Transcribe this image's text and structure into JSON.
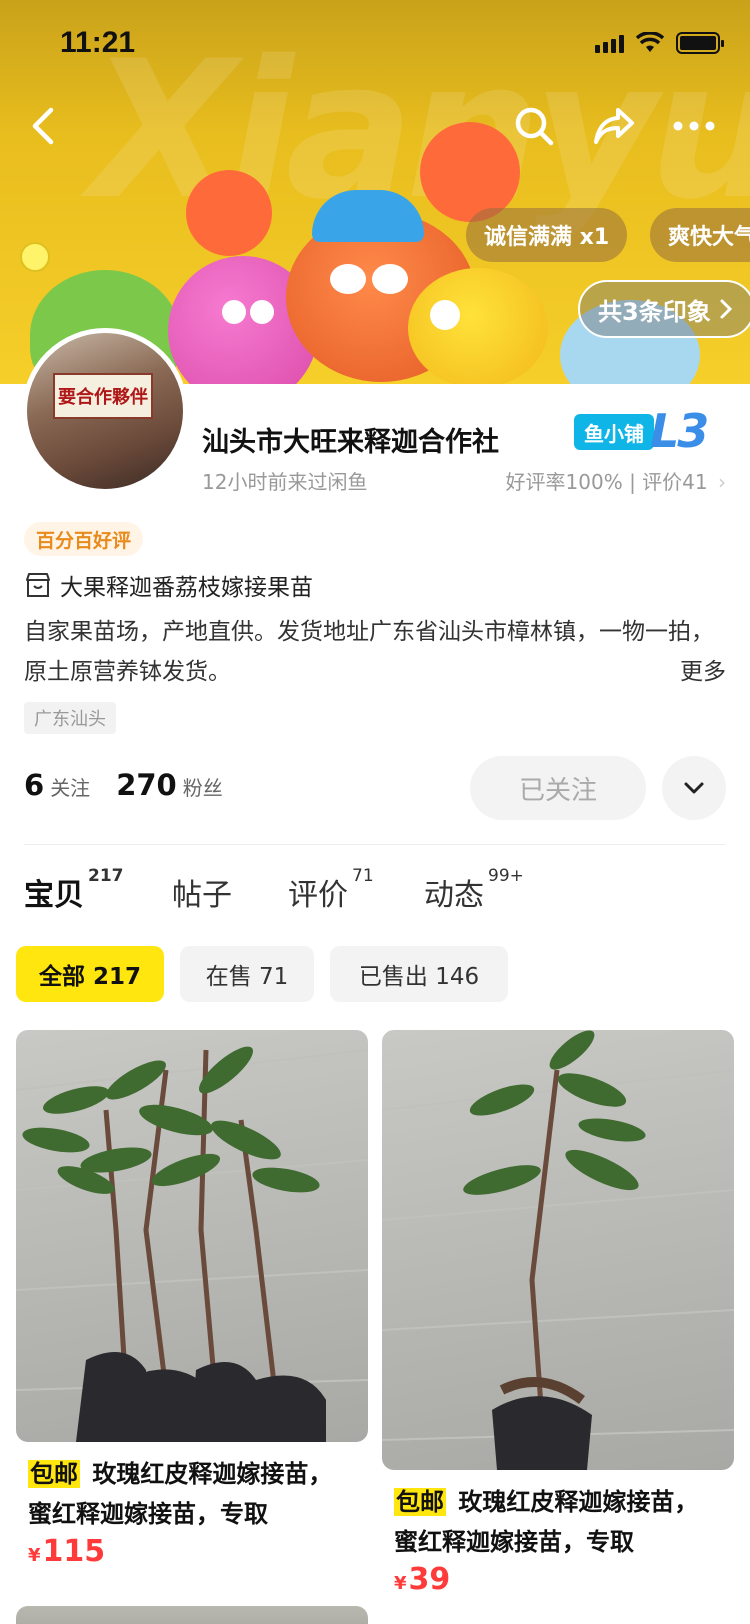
{
  "status_bar": {
    "time": "11:21"
  },
  "banner": {
    "watermark": "Xianyu",
    "tags": [
      "诚信满满 x1",
      "爽快大气"
    ],
    "impressions": "共3条印象"
  },
  "shop": {
    "avatar_text": "要合作夥伴",
    "name": "汕头市大旺来释迦合作社",
    "last_visit": "12小时前来过闲鱼",
    "level_badge": "鱼小铺",
    "level": "L3",
    "rating": "好评率100% | 评价41",
    "good_tag": "百分百好评",
    "title": "大果释迦番荔枝嫁接果苗",
    "description": "自家果苗场，产地直供。发货地址广东省汕头市樟林镇，一物一拍，原土原营养钵发货。",
    "more": "更多",
    "location": "广东汕头"
  },
  "stats": {
    "following_num": "6",
    "following_label": "关注",
    "fans_num": "270",
    "fans_label": "粉丝",
    "follow_button": "已关注"
  },
  "tabs": [
    {
      "label": "宝贝",
      "count": "217"
    },
    {
      "label": "帖子",
      "count": ""
    },
    {
      "label": "评价",
      "count": "71"
    },
    {
      "label": "动态",
      "count": "99+"
    }
  ],
  "filters": [
    "全部 217",
    "在售 71",
    "已售出 146"
  ],
  "products": [
    {
      "badge": "包邮",
      "title": "玫瑰红皮释迦嫁接苗，蜜红释迦嫁接苗，专取",
      "currency": "¥",
      "price": "115"
    },
    {
      "badge": "包邮",
      "title": "玫瑰红皮释迦嫁接苗，蜜红释迦嫁接苗，专取",
      "currency": "¥",
      "price": "39"
    }
  ],
  "colors": {
    "accent_yellow": "#ffe60f",
    "price_red": "#ff3a3a",
    "level_blue": "#3a8ee8"
  }
}
